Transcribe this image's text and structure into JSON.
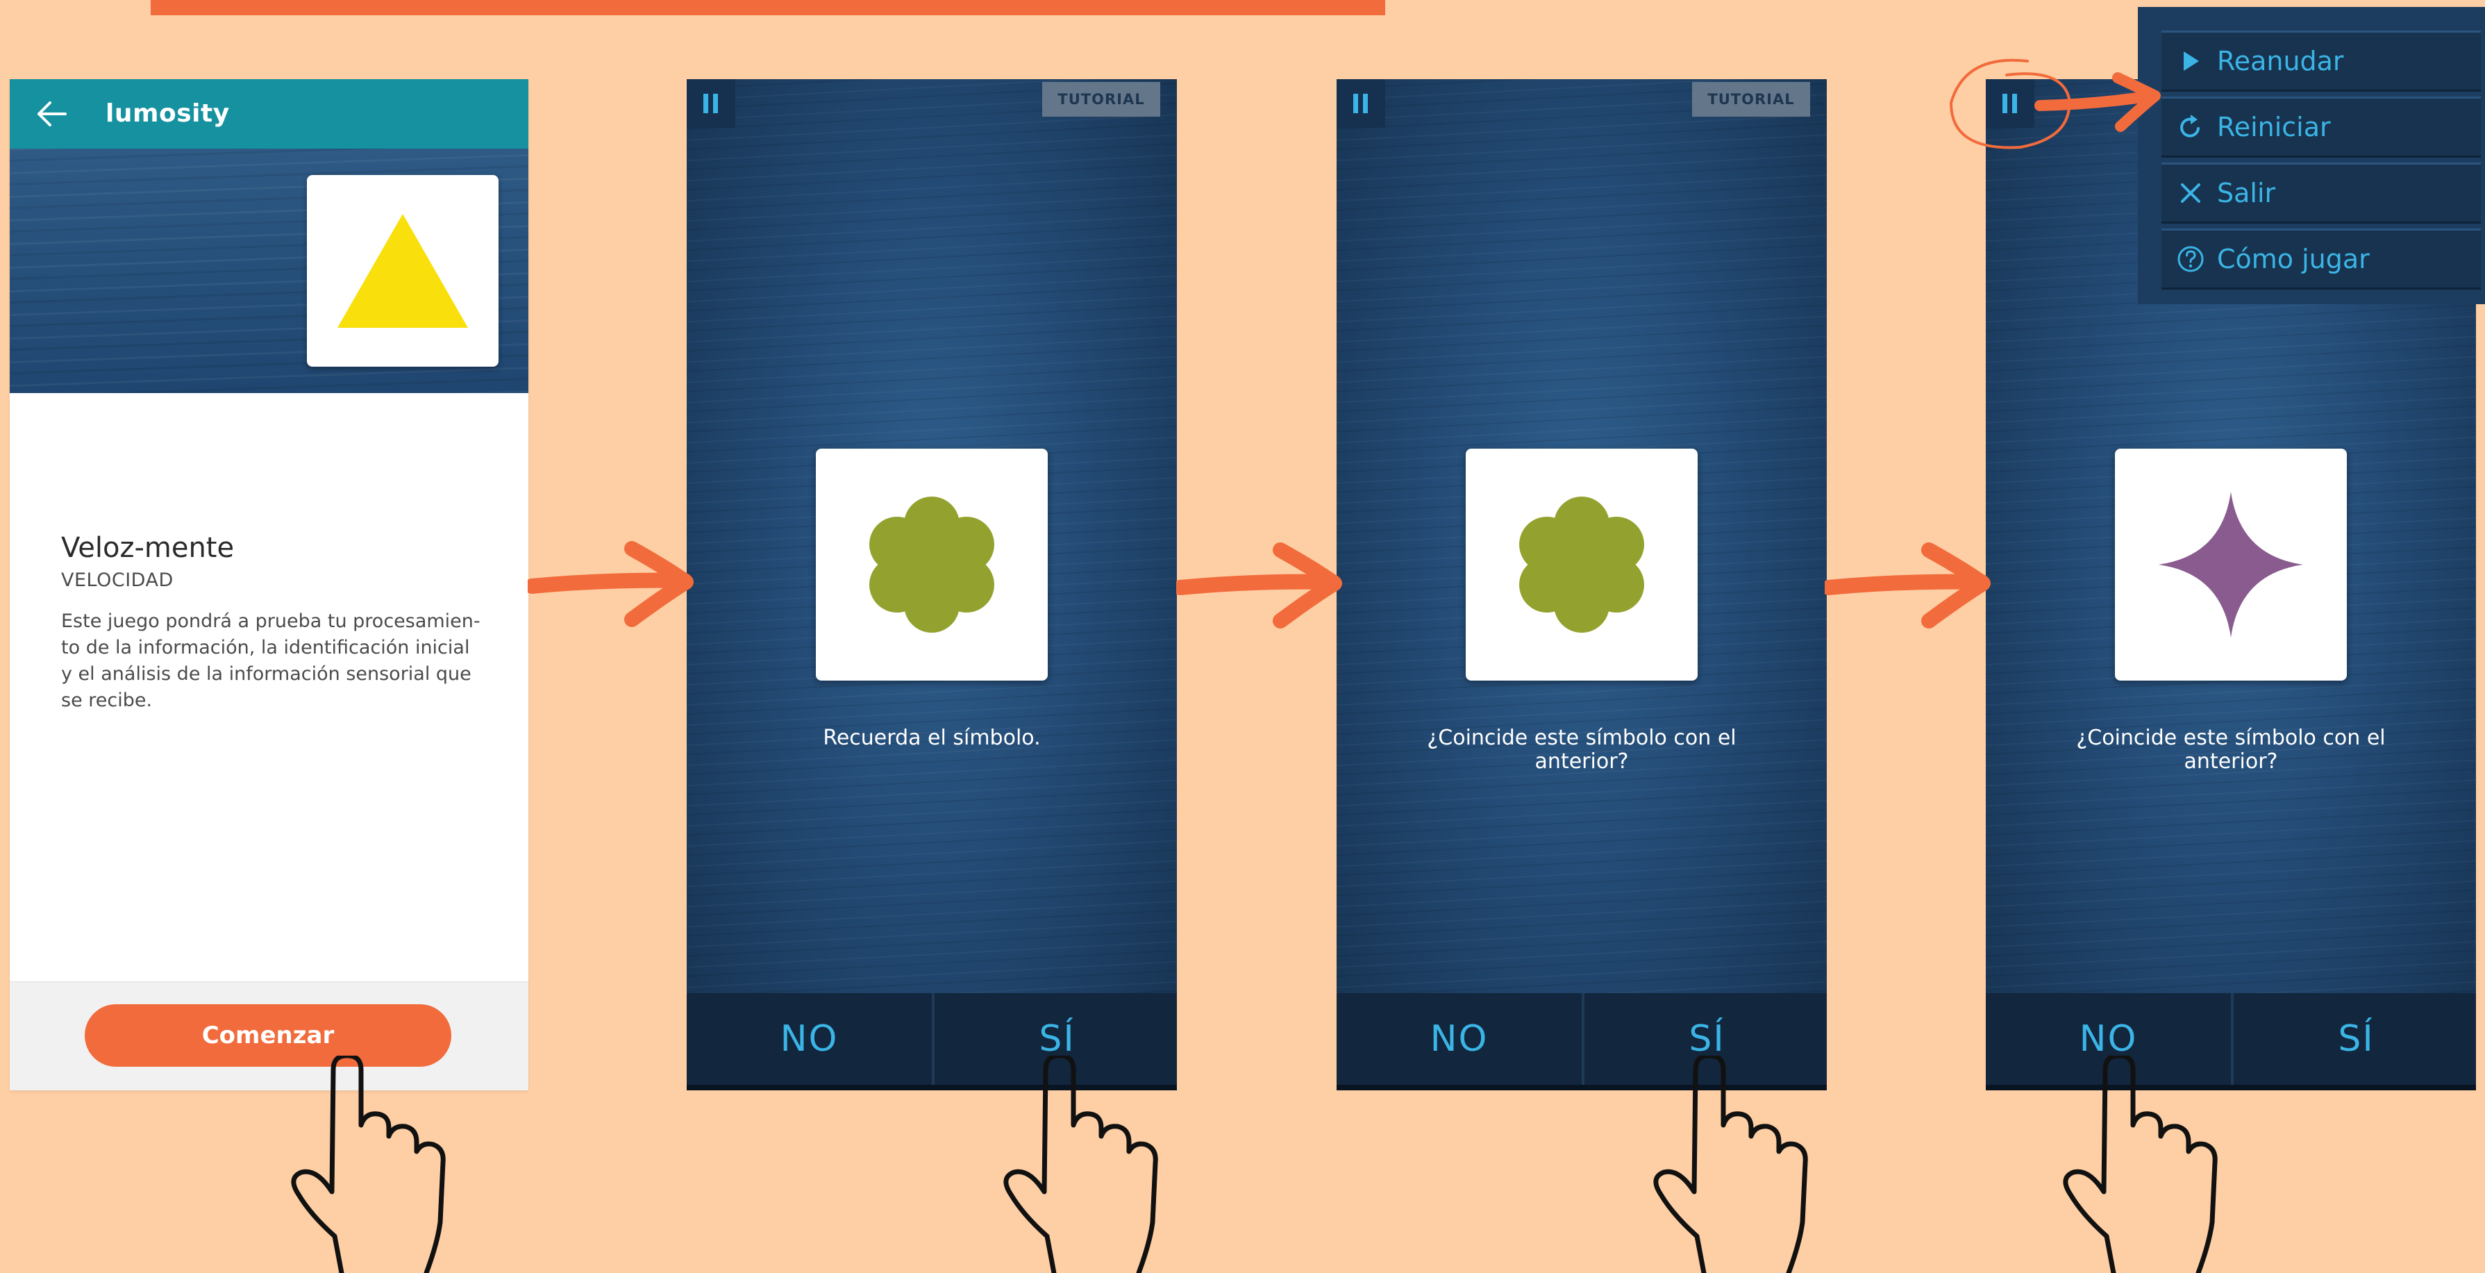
{
  "accent_color": "#f26b3c",
  "game_accent_color": "#3bb4e6",
  "intro_screen": {
    "brand": "lumosity",
    "back_icon": "arrow-left-icon",
    "game_title": "Veloz-mente",
    "category": "VELOCIDAD",
    "description": "Este juego pondrá a prueba tu procesamien-to de la información, la identificación inicial y el análisis de la información sensorial que se recibe.",
    "start_button": "Comenzar",
    "symbol": "yellow-triangle"
  },
  "game_screens": [
    {
      "badge": "TUTORIAL",
      "prompt": "Recuerda el símbolo.",
      "symbol": "green-flower",
      "no_label": "NO",
      "yes_label": "SÍ"
    },
    {
      "badge": "TUTORIAL",
      "prompt": "¿Coincide este símbolo con el anterior?",
      "symbol": "green-flower",
      "no_label": "NO",
      "yes_label": "SÍ"
    },
    {
      "prompt": "¿Coincide este símbolo con el anterior?",
      "symbol": "purple-star",
      "no_label": "NO",
      "yes_label": "SÍ"
    }
  ],
  "pause_menu": [
    {
      "label": "Reanudar",
      "icon": "play-icon"
    },
    {
      "label": "Reiniciar",
      "icon": "restart-icon"
    },
    {
      "label": "Salir",
      "icon": "close-icon"
    },
    {
      "label": "Cómo jugar",
      "icon": "help-icon"
    }
  ]
}
